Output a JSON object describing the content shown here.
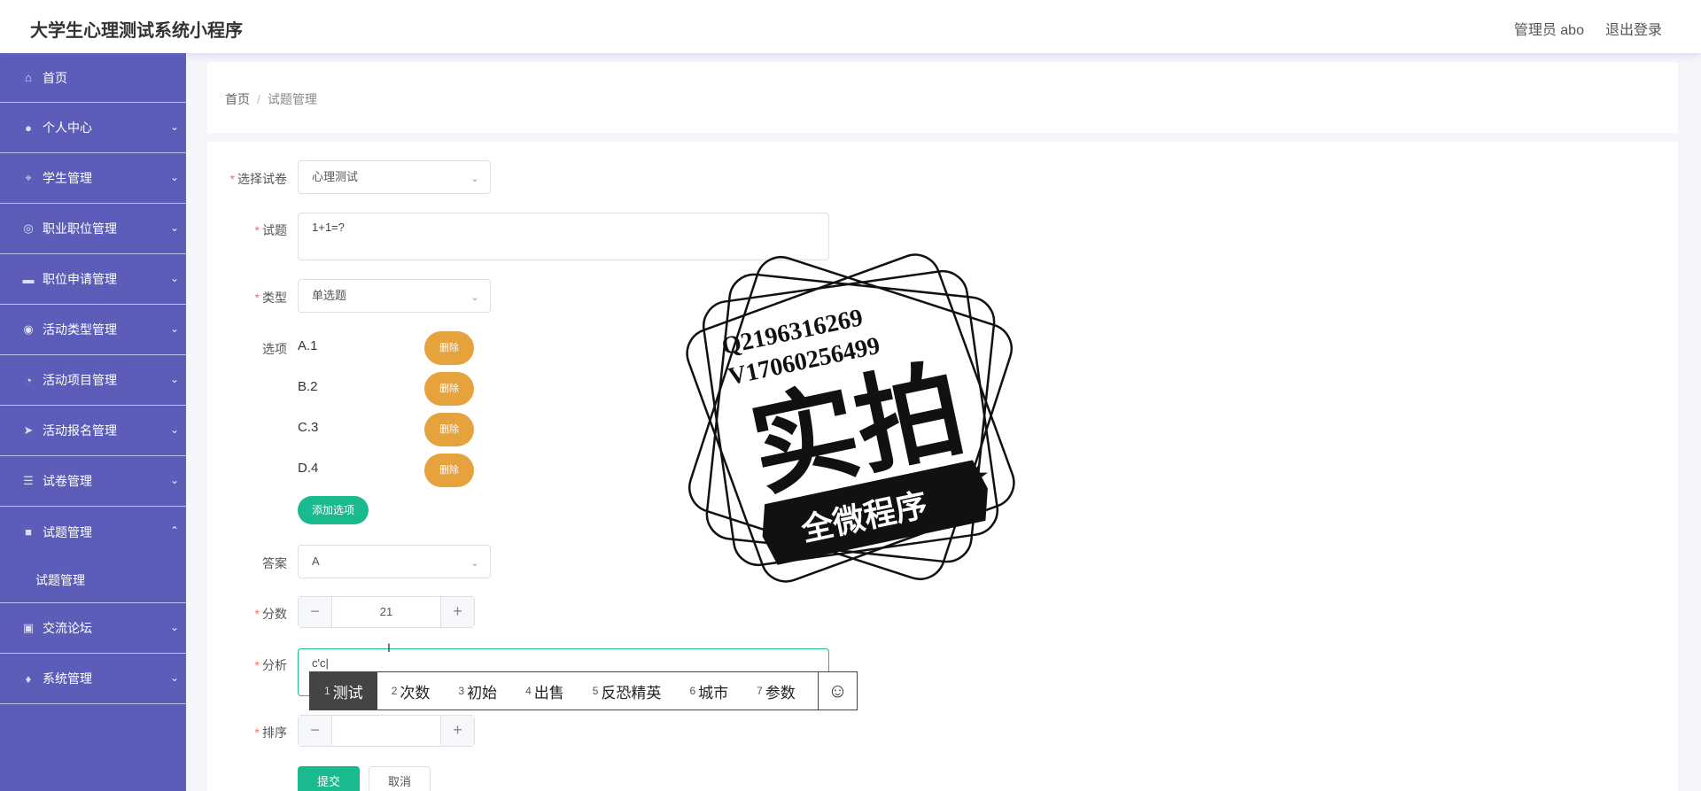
{
  "header": {
    "app_title": "大学生心理测试系统小程序",
    "user_label": "管理员 abo",
    "logout_label": "退出登录"
  },
  "sidebar": {
    "items": [
      {
        "label": "首页",
        "icon": "home-icon"
      },
      {
        "label": "个人中心",
        "icon": "user-icon"
      },
      {
        "label": "学生管理",
        "icon": "student-icon"
      },
      {
        "label": "职业职位管理",
        "icon": "target-icon"
      },
      {
        "label": "职位申请管理",
        "icon": "monitor-icon"
      },
      {
        "label": "活动类型管理",
        "icon": "compass-icon"
      },
      {
        "label": "活动项目管理",
        "icon": "clock-icon"
      },
      {
        "label": "活动报名管理",
        "icon": "send-icon"
      },
      {
        "label": "试卷管理",
        "icon": "list-icon"
      },
      {
        "label": "试题管理",
        "icon": "briefcase-icon"
      },
      {
        "label": "交流论坛",
        "icon": "clipboard-icon"
      },
      {
        "label": "系统管理",
        "icon": "mic-icon"
      }
    ],
    "sub_item": "试题管理"
  },
  "breadcrumb": {
    "home": "首页",
    "separator": "/",
    "current": "试题管理"
  },
  "form": {
    "paper_label": "选择试卷",
    "paper_value": "心理测试",
    "question_label": "试题",
    "question_value": "1+1=?",
    "type_label": "类型",
    "type_value": "单选题",
    "options_label": "选项",
    "options": [
      {
        "text": "A.1",
        "delete_label": "删除"
      },
      {
        "text": "B.2",
        "delete_label": "删除"
      },
      {
        "text": "C.3",
        "delete_label": "删除"
      },
      {
        "text": "D.4",
        "delete_label": "删除"
      }
    ],
    "add_option_label": "添加选项",
    "answer_label": "答案",
    "answer_value": "A",
    "score_label": "分数",
    "score_value": "21",
    "analysis_label": "分析",
    "analysis_value": "c'c|",
    "order_label": "排序",
    "order_value": "",
    "submit_label": "提交",
    "cancel_label": "取消"
  },
  "ime": {
    "candidates": [
      {
        "num": "1",
        "text": "测试"
      },
      {
        "num": "2",
        "text": "次数"
      },
      {
        "num": "3",
        "text": "初始"
      },
      {
        "num": "4",
        "text": "出售"
      },
      {
        "num": "5",
        "text": "反恐精英"
      },
      {
        "num": "6",
        "text": "城市"
      },
      {
        "num": "7",
        "text": "参数"
      }
    ],
    "emoji": "☺"
  },
  "watermark": {
    "line1": "Q2196316269",
    "line2": "V17060256499",
    "big": "实拍",
    "banner": "全微程序"
  }
}
